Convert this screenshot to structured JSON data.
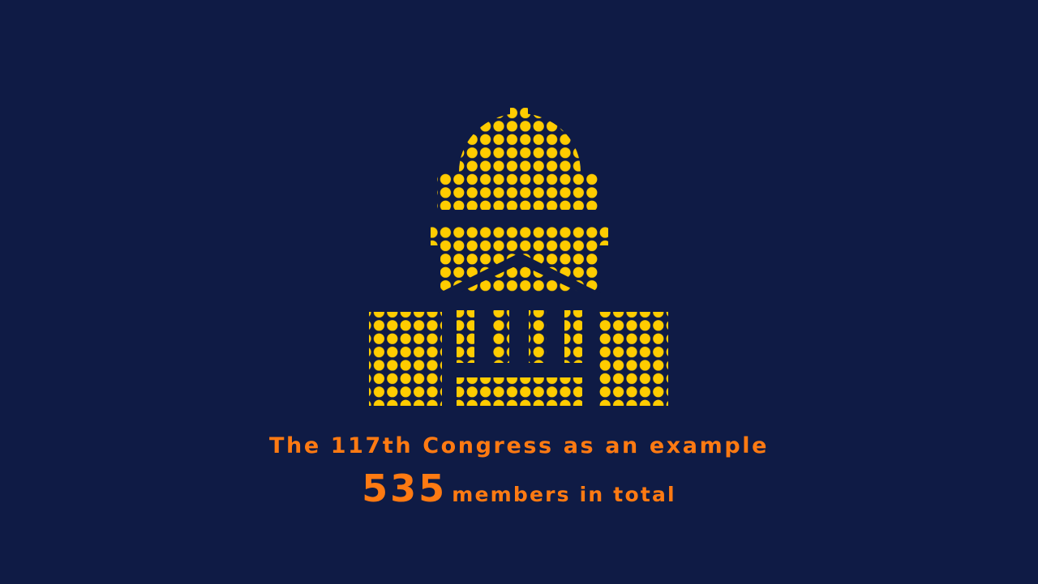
{
  "colors": {
    "background": "#0f1b45",
    "dots": "#ffcc00",
    "caption": "#ff7a12"
  },
  "icon": "capitol-building-icon",
  "caption": {
    "line1": "The 117th Congress as an example",
    "count": "535",
    "count_suffix": "members in total"
  }
}
